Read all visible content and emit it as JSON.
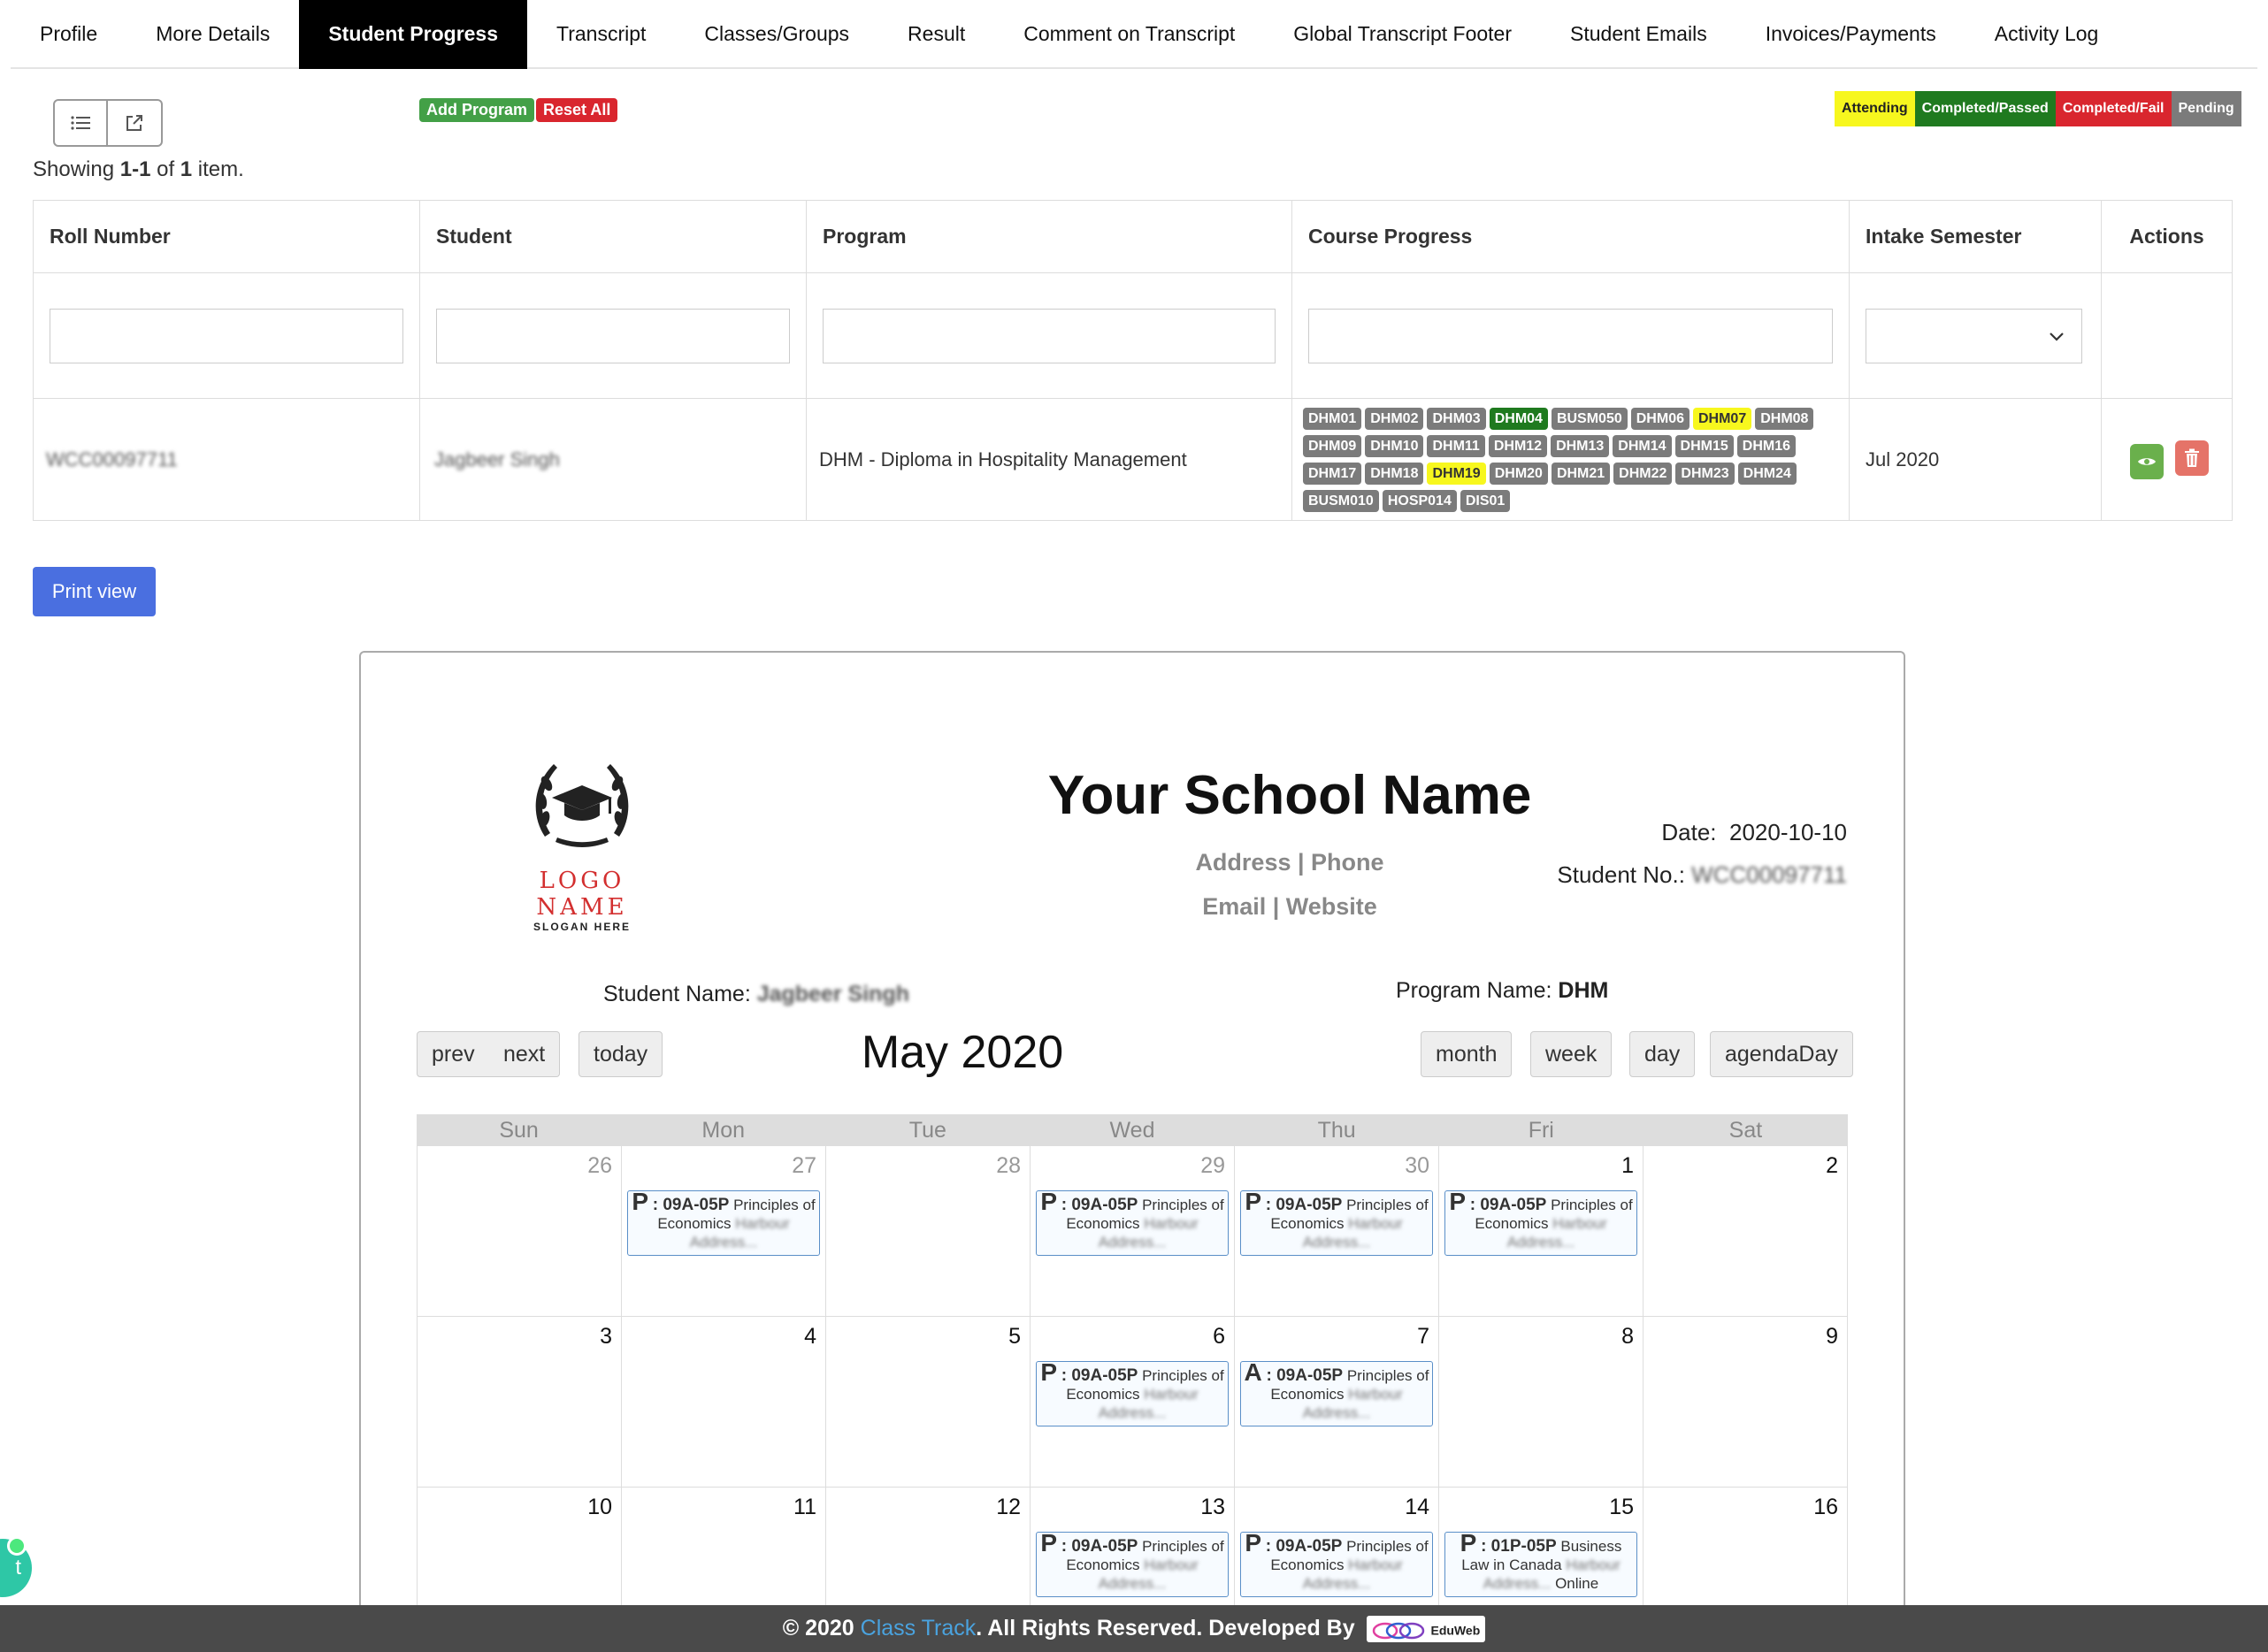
{
  "tabs": [
    {
      "label": "Profile",
      "active": false
    },
    {
      "label": "More Details",
      "active": false
    },
    {
      "label": "Student Progress",
      "active": true
    },
    {
      "label": "Transcript",
      "active": false
    },
    {
      "label": "Classes/Groups",
      "active": false
    },
    {
      "label": "Result",
      "active": false
    },
    {
      "label": "Comment on Transcript",
      "active": false
    },
    {
      "label": "Global Transcript Footer",
      "active": false
    },
    {
      "label": "Student Emails",
      "active": false
    },
    {
      "label": "Invoices/Payments",
      "active": false
    },
    {
      "label": "Activity Log",
      "active": false
    }
  ],
  "toolbar": {
    "add_program": "Add Program",
    "reset_all": "Reset All",
    "view_icons": [
      "list-icon",
      "external-link-icon"
    ]
  },
  "legend": [
    {
      "label": "Attending",
      "bg": "#f7f71e",
      "fg": "#222"
    },
    {
      "label": "Completed/Passed",
      "bg": "#1f7a1f",
      "fg": "#fff"
    },
    {
      "label": "Completed/Fail",
      "bg": "#d9262e",
      "fg": "#fff"
    },
    {
      "label": "Pending",
      "bg": "#7b7b7b",
      "fg": "#fff"
    }
  ],
  "summary": {
    "prefix": "Showing ",
    "range": "1-1",
    "mid": " of ",
    "total": "1",
    "suffix": " item."
  },
  "table": {
    "headers": [
      "Roll Number",
      "Student",
      "Program",
      "Course Progress",
      "Intake Semester",
      "Actions"
    ],
    "row": {
      "roll_number": "WCC00097711",
      "student": "Jagbeer Singh",
      "program": "DHM - Diploma in Hospitality Management",
      "intake": "Jul 2020",
      "courses": [
        {
          "code": "DHM01",
          "status": "pending"
        },
        {
          "code": "DHM02",
          "status": "pending"
        },
        {
          "code": "DHM03",
          "status": "pending"
        },
        {
          "code": "DHM04",
          "status": "passed"
        },
        {
          "code": "BUSM050",
          "status": "pending"
        },
        {
          "code": "DHM06",
          "status": "pending"
        },
        {
          "code": "DHM07",
          "status": "attending"
        },
        {
          "code": "DHM08",
          "status": "pending"
        },
        {
          "code": "DHM09",
          "status": "pending"
        },
        {
          "code": "DHM10",
          "status": "pending"
        },
        {
          "code": "DHM11",
          "status": "pending"
        },
        {
          "code": "DHM12",
          "status": "pending"
        },
        {
          "code": "DHM13",
          "status": "pending"
        },
        {
          "code": "DHM14",
          "status": "pending"
        },
        {
          "code": "DHM15",
          "status": "pending"
        },
        {
          "code": "DHM16",
          "status": "pending"
        },
        {
          "code": "DHM17",
          "status": "pending"
        },
        {
          "code": "DHM18",
          "status": "pending"
        },
        {
          "code": "DHM19",
          "status": "attending"
        },
        {
          "code": "DHM20",
          "status": "pending"
        },
        {
          "code": "DHM21",
          "status": "pending"
        },
        {
          "code": "DHM22",
          "status": "pending"
        },
        {
          "code": "DHM23",
          "status": "pending"
        },
        {
          "code": "DHM24",
          "status": "pending"
        },
        {
          "code": "BUSM010",
          "status": "pending"
        },
        {
          "code": "HOSP014",
          "status": "pending"
        },
        {
          "code": "DIS01",
          "status": "pending"
        }
      ]
    }
  },
  "print_view": "Print view",
  "sheet": {
    "logo_name": "LOGO NAME",
    "logo_slogan": "SLOGAN HERE",
    "school_name": "Your School Name",
    "address_line": "Address | Phone",
    "contact_line": "Email | Website",
    "date_label": "Date:",
    "date_value": "2020-10-10",
    "student_no_label": "Student No.:",
    "student_no_value": "WCC00097711",
    "student_name_label": "Student Name:",
    "student_name_value": "Jagbeer Singh",
    "program_name_label": "Program Name:",
    "program_name_value": "DHM"
  },
  "calendar": {
    "title": "May 2020",
    "nav": {
      "prev": "prev",
      "next": "next",
      "today": "today"
    },
    "views": [
      "month",
      "week",
      "day",
      "agendaDay"
    ],
    "weekdays": [
      "Sun",
      "Mon",
      "Tue",
      "Wed",
      "Thu",
      "Fri",
      "Sat"
    ],
    "weeks": [
      [
        {
          "day": "26",
          "other": true
        },
        {
          "day": "27",
          "other": true,
          "event": {
            "code": "P",
            "time": ": 09A-05P",
            "title": "Principles of Economics",
            "location": "Harbour Address..."
          }
        },
        {
          "day": "28",
          "other": true
        },
        {
          "day": "29",
          "other": true,
          "event": {
            "code": "P",
            "time": ": 09A-05P",
            "title": "Principles of Economics",
            "location": "Harbour Address..."
          }
        },
        {
          "day": "30",
          "other": true,
          "event": {
            "code": "P",
            "time": ": 09A-05P",
            "title": "Principles of Economics",
            "location": "Harbour Address..."
          }
        },
        {
          "day": "1",
          "other": false,
          "event": {
            "code": "P",
            "time": ": 09A-05P",
            "title": "Principles of Economics",
            "location": "Harbour Address..."
          }
        },
        {
          "day": "2",
          "other": false
        }
      ],
      [
        {
          "day": "3",
          "other": false
        },
        {
          "day": "4",
          "other": false
        },
        {
          "day": "5",
          "other": false
        },
        {
          "day": "6",
          "other": false,
          "event": {
            "code": "P",
            "time": ": 09A-05P",
            "title": "Principles of Economics",
            "location": "Harbour Address..."
          }
        },
        {
          "day": "7",
          "other": false,
          "event": {
            "code": "A",
            "time": ": 09A-05P",
            "title": "Principles of Economics",
            "location": "Harbour Address..."
          }
        },
        {
          "day": "8",
          "other": false
        },
        {
          "day": "9",
          "other": false
        }
      ],
      [
        {
          "day": "10",
          "other": false
        },
        {
          "day": "11",
          "other": false
        },
        {
          "day": "12",
          "other": false
        },
        {
          "day": "13",
          "other": false,
          "event": {
            "code": "P",
            "time": ": 09A-05P",
            "title": "Principles of Economics",
            "location": "Harbour Address..."
          }
        },
        {
          "day": "14",
          "other": false,
          "event": {
            "code": "P",
            "time": ": 09A-05P",
            "title": "Principles of Economics",
            "location": "Harbour Address..."
          }
        },
        {
          "day": "15",
          "other": false,
          "event": {
            "code": "P",
            "time": ": 01P-05P",
            "title": "Business Law in Canada",
            "location": "Harbour Address...",
            "suffix": "Online"
          }
        },
        {
          "day": "16",
          "other": false
        }
      ]
    ]
  },
  "footer": {
    "prefix": "© 2020 ",
    "brand": "Class Track",
    "suffix": ". All Rights Reserved. Developed By",
    "dev_logo": "EduWeb"
  },
  "chat": {
    "glyph": "t"
  },
  "colors": {
    "attending": "#f7f71e",
    "passed": "#1f7a1f",
    "fail": "#d9262e",
    "pending": "#7b7b7b",
    "add_program": "#43a047",
    "reset_all": "#d9262e",
    "view_btn": "#6ab04c",
    "delete_btn": "#e57368"
  }
}
